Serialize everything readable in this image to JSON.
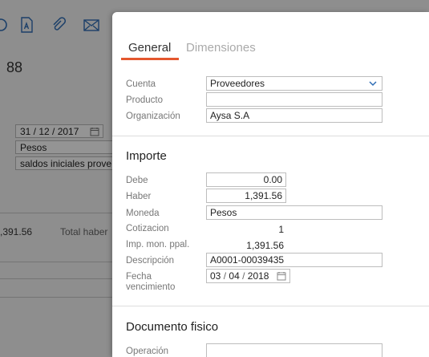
{
  "background": {
    "big_number": "88",
    "date_field": "31 / 12 / 2017",
    "currency_field": "Pesos",
    "description_field": "saldos iniciales prove",
    "amount_text": ",391.56",
    "total_label": "Total haber"
  },
  "tabs": {
    "general": "General",
    "dimensiones": "Dimensiones"
  },
  "fields": {
    "cuenta_label": "Cuenta",
    "cuenta_value": "Proveedores",
    "producto_label": "Producto",
    "producto_value": "",
    "organizacion_label": "Organización",
    "organizacion_value": "Aysa S.A"
  },
  "importe": {
    "title": "Importe",
    "debe_label": "Debe",
    "debe_value": "0.00",
    "haber_label": "Haber",
    "haber_value": "1,391.56",
    "moneda_label": "Moneda",
    "moneda_value": "Pesos",
    "cotizacion_label": "Cotizacion",
    "cotizacion_value": "1",
    "imp_label": "Imp. mon. ppal.",
    "imp_value": "1,391.56",
    "descripcion_label": "Descripción",
    "descripcion_value": "A0001-00039435",
    "fecha_label_1": "Fecha",
    "fecha_label_2": "vencimiento",
    "fecha_day": "03",
    "fecha_month": "04",
    "fecha_year": "2018"
  },
  "documento": {
    "title": "Documento fisico",
    "operacion_label": "Operación",
    "operacion_value": ""
  },
  "colors": {
    "accent": "#e4572e",
    "icon_blue": "#2f6db5"
  }
}
